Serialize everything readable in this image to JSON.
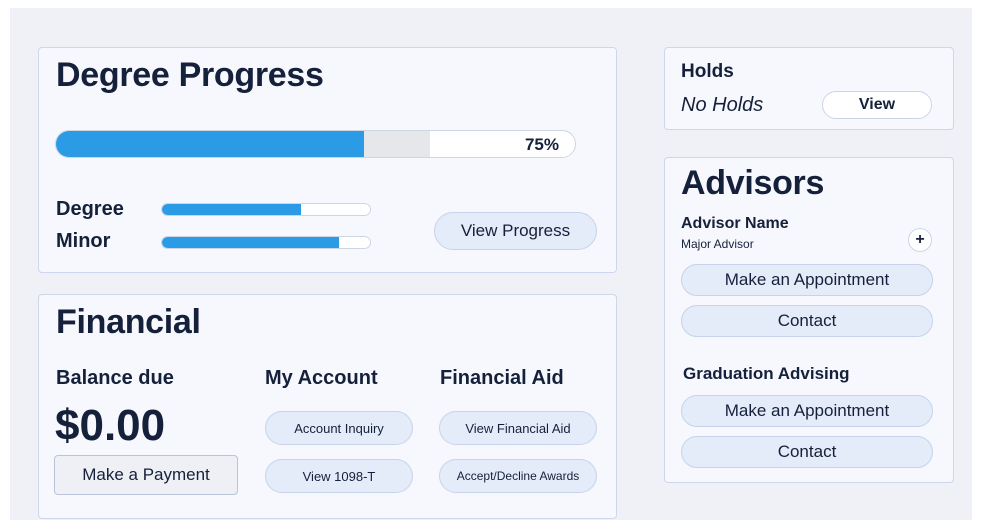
{
  "degree": {
    "title": "Degree Progress",
    "overall_progress": 0.75,
    "overall_secondary": 0.72,
    "overall_label": "75%",
    "degree_label": "Degree",
    "degree_progress": 0.67,
    "minor_label": "Minor",
    "minor_progress": 0.85,
    "view_progress_label": "View Progress"
  },
  "financial": {
    "title": "Financial",
    "balance_heading": "Balance due",
    "balance_amount": "$0.00",
    "make_payment_label": "Make a Payment",
    "account_heading": "My Account",
    "account_inquiry_label": "Account Inquiry",
    "view_1098_label": "View 1098-T",
    "aid_heading": "Financial Aid",
    "view_aid_label": "View Financial Aid",
    "accept_decline_label": "Accept/Decline Awards"
  },
  "holds": {
    "title": "Holds",
    "status": "No Holds",
    "view_label": "View"
  },
  "advisors": {
    "title": "Advisors",
    "advisor_name": "Advisor Name",
    "advisor_role": "Major Advisor",
    "add_icon_glyph": "+",
    "appointment_label": "Make an Appointment",
    "contact_label": "Contact",
    "graduation_label": "Graduation Advising",
    "grad_appointment_label": "Make an Appointment",
    "grad_contact_label": "Contact"
  },
  "colors": {
    "accent": "#2b9be6",
    "background": "#eff1f6",
    "card": "#f6f8fd",
    "button": "#e4ecfa",
    "text": "#15203a"
  }
}
